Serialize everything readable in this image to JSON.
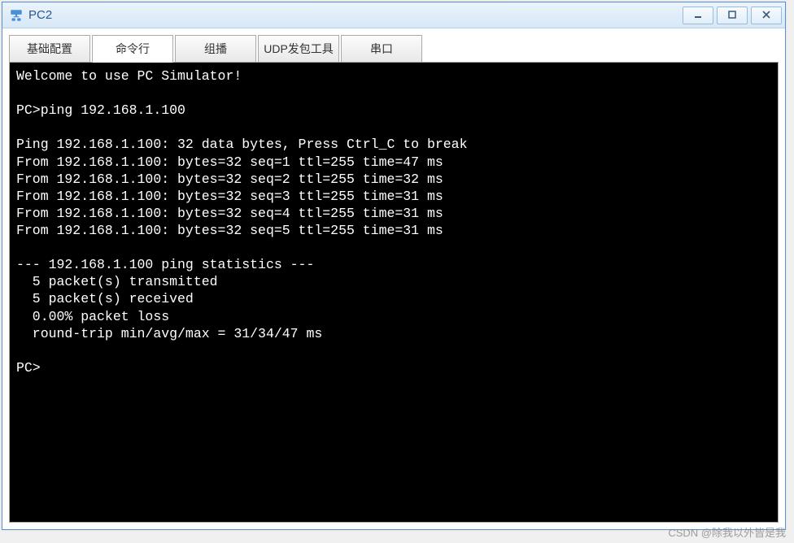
{
  "window": {
    "title": "PC2"
  },
  "tabs": {
    "items": [
      {
        "label": "基础配置",
        "active": false
      },
      {
        "label": "命令行",
        "active": true
      },
      {
        "label": "组播",
        "active": false
      },
      {
        "label": "UDP发包工具",
        "active": false
      },
      {
        "label": "串口",
        "active": false
      }
    ]
  },
  "terminal": {
    "lines": [
      "Welcome to use PC Simulator!",
      "",
      "PC>ping 192.168.1.100",
      "",
      "Ping 192.168.1.100: 32 data bytes, Press Ctrl_C to break",
      "From 192.168.1.100: bytes=32 seq=1 ttl=255 time=47 ms",
      "From 192.168.1.100: bytes=32 seq=2 ttl=255 time=32 ms",
      "From 192.168.1.100: bytes=32 seq=3 ttl=255 time=31 ms",
      "From 192.168.1.100: bytes=32 seq=4 ttl=255 time=31 ms",
      "From 192.168.1.100: bytes=32 seq=5 ttl=255 time=31 ms",
      "",
      "--- 192.168.1.100 ping statistics ---",
      "  5 packet(s) transmitted",
      "  5 packet(s) received",
      "  0.00% packet loss",
      "  round-trip min/avg/max = 31/34/47 ms",
      "",
      "PC>"
    ]
  },
  "watermark": "CSDN @除我以外皆是我"
}
